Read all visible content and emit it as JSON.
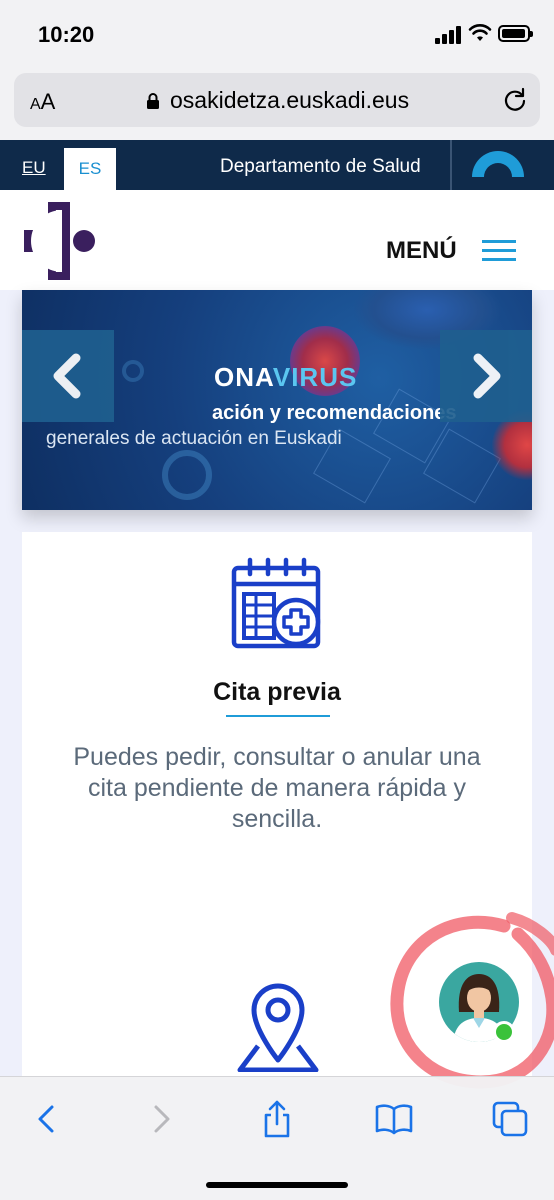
{
  "status_bar": {
    "time": "10:20",
    "icons": [
      "signal-icon",
      "wifi-icon",
      "battery-icon"
    ]
  },
  "browser": {
    "text_size_label": "AA",
    "url": "osakidetza.euskadi.eus",
    "icons": [
      "lock-icon",
      "reload-icon"
    ]
  },
  "site_topbar": {
    "lang_eu": "EU",
    "lang_es": "ES",
    "active_lang": "ES",
    "department": "Departamento de Salud"
  },
  "header": {
    "menu_label": "MENÚ"
  },
  "banner": {
    "title_part1": "ONA",
    "title_part2": "VIRUS",
    "subtitle_line1": "ación y recomendaciones",
    "subtitle_line2": "generales de actuación en Euskadi"
  },
  "card": {
    "title": "Cita previa",
    "description": "Puedes pedir, consultar o anular una cita pendiente de manera rápida y sencilla."
  },
  "toolbar": {
    "icons": [
      "back-icon",
      "forward-icon",
      "share-icon",
      "bookmarks-icon",
      "tabs-icon"
    ]
  },
  "colors": {
    "navy": "#0f2a4a",
    "accent_blue": "#1f9cd8",
    "logo_purple": "#3a1f5e",
    "icon_blue": "#1a3fc8",
    "online_green": "#3ac23a"
  }
}
